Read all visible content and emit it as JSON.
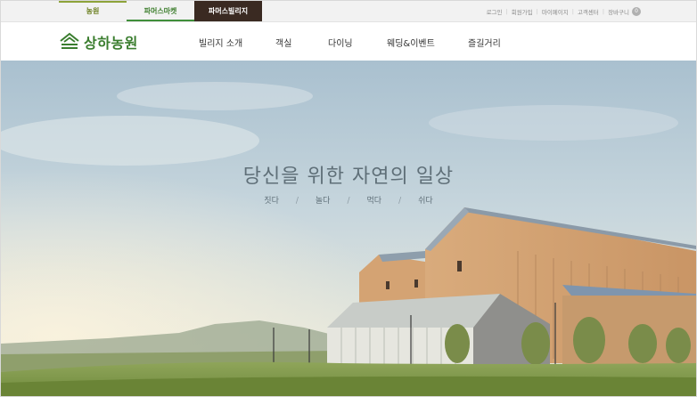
{
  "site_tabs": [
    {
      "label": "농원"
    },
    {
      "label": "파머스마켓"
    },
    {
      "label": "파머스빌리지"
    }
  ],
  "util_links": [
    "로그인",
    "회원가입",
    "마이페이지",
    "고객센터",
    "장바구니"
  ],
  "cart_count": "0",
  "logo": {
    "text": "상하농원"
  },
  "nav": [
    "빌리지 소개",
    "객실",
    "다이닝",
    "웨딩&이벤트",
    "즐길거리"
  ],
  "hero": {
    "headline": "당신을 위한 자연의 일상",
    "tags": [
      "짓다",
      "놀다",
      "먹다",
      "쉬다"
    ]
  },
  "colors": {
    "brand_green": "#3a7d2e",
    "active_tab_bg": "#3a2a22",
    "headline": "#5f6f78"
  }
}
